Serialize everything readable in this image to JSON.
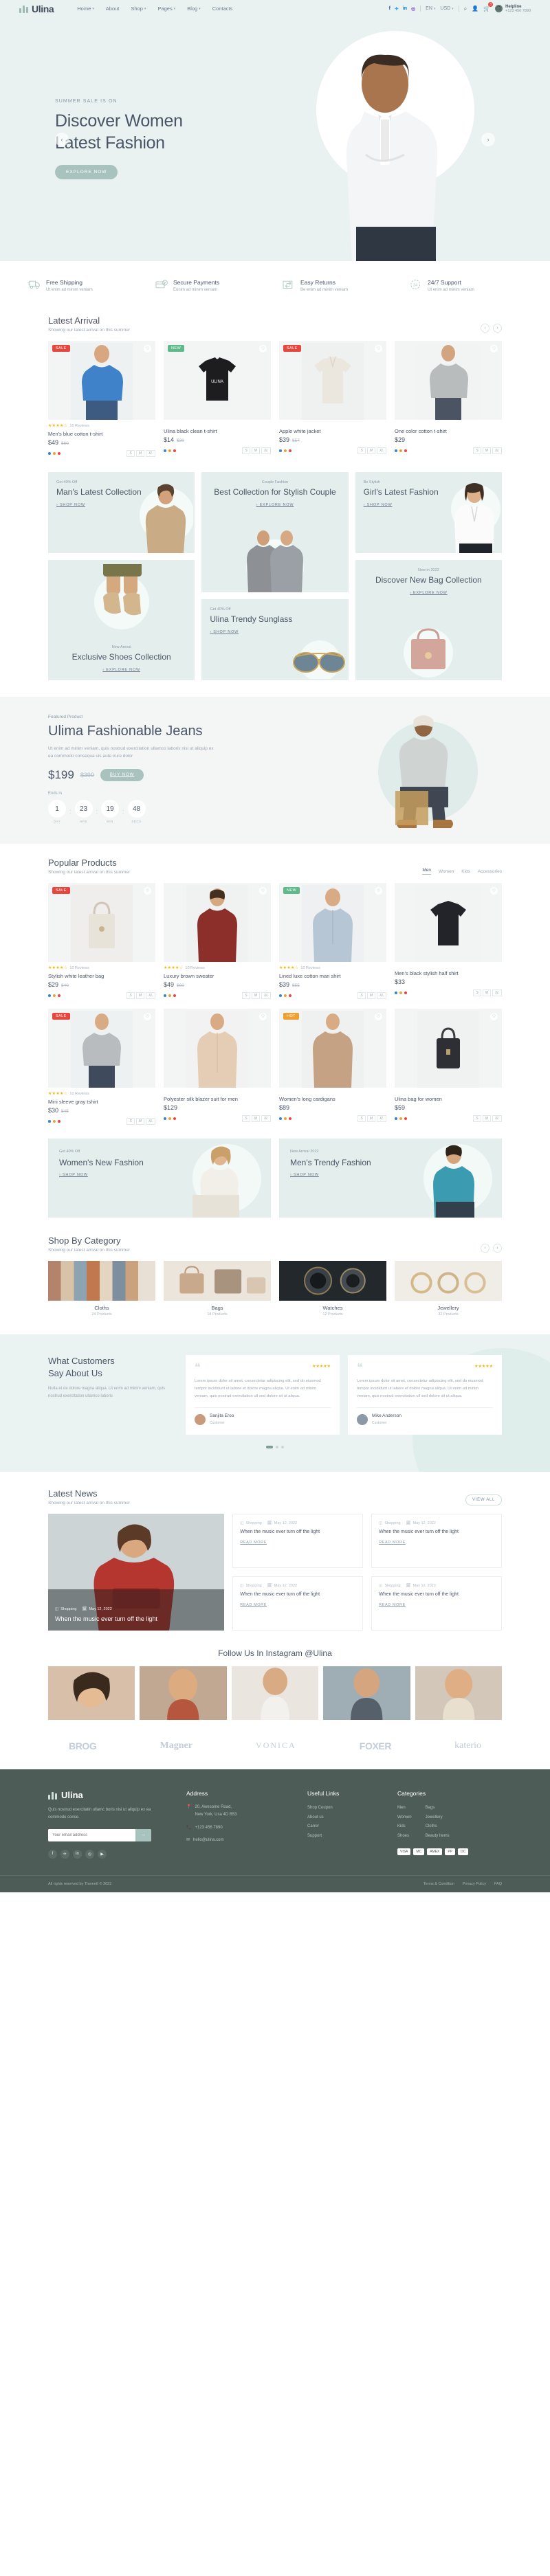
{
  "header": {
    "brand": "Ulina",
    "nav": [
      {
        "label": "Home",
        "caret": true
      },
      {
        "label": "About",
        "caret": false
      },
      {
        "label": "Shop",
        "caret": true
      },
      {
        "label": "Pages",
        "caret": true
      },
      {
        "label": "Blog",
        "caret": true
      },
      {
        "label": "Contacts",
        "caret": false
      }
    ],
    "socials": [
      "f",
      "t",
      "in",
      "ig"
    ],
    "language": "EN",
    "currency": "USD",
    "cart_count": "3",
    "helpline_label": "Helpline",
    "helpline_number": "+123 456 7890"
  },
  "hero": {
    "eyebrow": "SUMMER SALE IS ON",
    "title_line1": "Discover Women",
    "title_line2": "Latest Fashion",
    "cta": "EXPLORE NOW",
    "prev": "‹",
    "next": "›"
  },
  "features": [
    {
      "icon": "truck-icon",
      "title": "Free Shipping",
      "sub": "Ut enim ad minim veniam"
    },
    {
      "icon": "card-shield-icon",
      "title": "Secure Payments",
      "sub": "Eonim ad minim veniam"
    },
    {
      "icon": "return-box-icon",
      "title": "Easy Returns",
      "sub": "Be enim ad minim veniam"
    },
    {
      "icon": "clock-24-icon",
      "title": "24/7 Support",
      "sub": "Ut enim ad minim veniam"
    }
  ],
  "latest_arrival": {
    "title": "Latest Arrival",
    "subtitle": "Showing our latest arrival on this summer",
    "products": [
      {
        "tag": "SALE",
        "tag_type": "sale",
        "name": "Men's blue cotton t-shirt",
        "price": "$49",
        "old": "$60",
        "stars": "★★★★☆",
        "reviews": "10 Reviews",
        "colors": [
          "#3b82c4",
          "#e8a33d",
          "#e8473f"
        ],
        "sizes": [
          "S",
          "M",
          "XL"
        ],
        "photo": "men-blue-tshirt"
      },
      {
        "tag": "NEW",
        "tag_type": "new",
        "name": "Ulina black clean t-shirt",
        "price": "$14",
        "old": "$30",
        "stars": "",
        "reviews": "",
        "colors": [
          "#3b82c4",
          "#e8a33d",
          "#e8473f"
        ],
        "sizes": [
          "S",
          "M",
          "XL"
        ],
        "photo": "black-tshirt"
      },
      {
        "tag": "SALE",
        "tag_type": "sale",
        "name": "Apple white jacket",
        "price": "$39",
        "old": "$57",
        "stars": "",
        "reviews": "",
        "colors": [
          "#3b82c4",
          "#e8a33d",
          "#e8473f"
        ],
        "sizes": [
          "S",
          "M",
          "XL"
        ],
        "photo": "white-jacket"
      },
      {
        "tag": "",
        "tag_type": "",
        "name": "One color cotton t-shirt",
        "price": "$29",
        "old": "",
        "stars": "",
        "reviews": "",
        "colors": [
          "#3b82c4",
          "#e8a33d",
          "#e8473f"
        ],
        "sizes": [
          "S",
          "M",
          "XL"
        ],
        "photo": "grey-sweater"
      }
    ]
  },
  "collections": [
    {
      "eyebrow": "Get 40% Off",
      "title": "Man's Latest Collection",
      "link": "SHOP NOW",
      "name": "mans-latest-collection"
    },
    {
      "eyebrow": "Couple Fashion",
      "title": "Best Collection for Stylish Couple",
      "link": "EXPLORE NOW",
      "name": "couple-collection"
    },
    {
      "eyebrow": "Be Stylish",
      "title": "Girl's Latest Fashion",
      "link": "SHOP NOW",
      "name": "girls-latest-fashion"
    },
    {
      "eyebrow": "New Arrival",
      "title": "Exclusive Shoes Collection",
      "link": "EXPLORE NOW",
      "name": "exclusive-shoes"
    },
    {
      "eyebrow": "Get 40% Off",
      "title": "Ulina Trendy Sunglass",
      "link": "SHOP NOW",
      "name": "trendy-sunglass"
    },
    {
      "eyebrow": "New in 2022",
      "title": "Discover New Bag Collection",
      "link": "EXPLORE NOW",
      "name": "new-bag-collection"
    }
  ],
  "deal": {
    "eyebrow": "Featured Product",
    "title": "Ulima Fashionable Jeans",
    "desc": "Ut enim ad minim veniam, quis nostrud exercitation ullamco laboris nisi ut aliquip ex ea commodo consequa uis aute irure dolor",
    "price": "$199",
    "old_price": "$399",
    "cta": "BUY NOW",
    "ends_label": "Ends in",
    "timer": [
      {
        "value": "1",
        "label": "DAY"
      },
      {
        "value": "23",
        "label": "HRS"
      },
      {
        "value": "19",
        "label": "MIN"
      },
      {
        "value": "48",
        "label": "SECS"
      }
    ]
  },
  "popular": {
    "title": "Popular Products",
    "subtitle": "Showing our latest arrival on this summer",
    "filters": [
      "Men",
      "Women",
      "Kids",
      "Accessories"
    ],
    "active_filter": "Men",
    "products": [
      {
        "tag": "SALE",
        "tag_type": "sale",
        "name": "Stylish white leather bag",
        "price": "$29",
        "old": "$40",
        "stars": "★★★★☆",
        "reviews": "10 Reviews",
        "colors": [
          "#3b82c4",
          "#e8a33d",
          "#e8473f"
        ],
        "sizes": [
          "S",
          "M",
          "XL"
        ],
        "photo": "white-leather-bag"
      },
      {
        "tag": "",
        "tag_type": "",
        "name": "Luxury brown sweater",
        "price": "$49",
        "old": "$60",
        "stars": "★★★★☆",
        "reviews": "10 Reviews",
        "colors": [
          "#3b82c4",
          "#e8a33d",
          "#e8473f"
        ],
        "sizes": [
          "S",
          "M",
          "XL"
        ],
        "photo": "brown-sweater"
      },
      {
        "tag": "NEW",
        "tag_type": "new",
        "name": "Lined luxe cotton man shirt",
        "price": "$39",
        "old": "$55",
        "stars": "★★★★☆",
        "reviews": "10 Reviews",
        "colors": [
          "#3b82c4",
          "#e8a33d",
          "#e8473f"
        ],
        "sizes": [
          "S",
          "M",
          "XL"
        ],
        "photo": "cotton-man-shirt"
      },
      {
        "tag": "",
        "tag_type": "",
        "name": "Men's black stylish half shirt",
        "price": "$33",
        "old": "",
        "stars": "",
        "reviews": "",
        "colors": [
          "#3b82c4",
          "#e8a33d",
          "#e8473f"
        ],
        "sizes": [
          "S",
          "M",
          "XL"
        ],
        "photo": "black-half-shirt"
      },
      {
        "tag": "SALE",
        "tag_type": "sale",
        "name": "Mini sleeve gray tshirt",
        "price": "$30",
        "old": "$45",
        "stars": "★★★★☆",
        "reviews": "10 Reviews",
        "colors": [
          "#3b82c4",
          "#e8a33d",
          "#e8473f"
        ],
        "sizes": [
          "S",
          "M",
          "XL"
        ],
        "photo": "gray-tshirt"
      },
      {
        "tag": "",
        "tag_type": "",
        "name": "Polyester silk blazer suit for men",
        "price": "$129",
        "old": "",
        "stars": "",
        "reviews": "",
        "colors": [
          "#3b82c4",
          "#e8a33d",
          "#e8473f"
        ],
        "sizes": [
          "S",
          "M",
          "XL"
        ],
        "photo": "blazer-suit"
      },
      {
        "tag": "HOT",
        "tag_type": "hot",
        "name": "Women's long cardigans",
        "price": "$89",
        "old": "",
        "stars": "",
        "reviews": "",
        "colors": [
          "#3b82c4",
          "#e8a33d",
          "#e8473f"
        ],
        "sizes": [
          "S",
          "M",
          "XL"
        ],
        "photo": "long-cardigan"
      },
      {
        "tag": "",
        "tag_type": "",
        "name": "Ulina bag for women",
        "price": "$59",
        "old": "",
        "stars": "",
        "reviews": "",
        "colors": [
          "#3b82c4",
          "#e8a33d",
          "#e8473f"
        ],
        "sizes": [
          "S",
          "M",
          "XL"
        ],
        "photo": "women-bag"
      }
    ]
  },
  "two_banners": [
    {
      "eyebrow": "Get 40% Off",
      "title": "Women's New Fashion",
      "link": "SHOP NOW",
      "name": "womens-new-fashion"
    },
    {
      "eyebrow": "New Arrival 2022",
      "title": "Men's Trendy Fashion",
      "link": "SHOP NOW",
      "name": "mens-trendy-fashion"
    }
  ],
  "category": {
    "title": "Shop By Category",
    "subtitle": "Showing our latest arrival on this summer",
    "items": [
      {
        "name": "Cloths",
        "count": "24 Products",
        "photo": "cloths-rack"
      },
      {
        "name": "Bags",
        "count": "18 Products",
        "photo": "bags-shelf"
      },
      {
        "name": "Watches",
        "count": "12 Products",
        "photo": "watches"
      },
      {
        "name": "Jewellery",
        "count": "32 Products",
        "photo": "jewellery"
      }
    ]
  },
  "testimonials": {
    "title_line1": "What Customers",
    "title_line2": "Say About Us",
    "desc": "Nulla et de dolore magna aliqua. Ut enim ad minim veniam, quis nostrud exercitation ullamco laboris",
    "cards": [
      {
        "stars": "★★★★★",
        "text": "Lorem ipsum dolor sit amet, consectetur adipiscing elit, sed do eiusmod tempor incididunt ut labore et dolore magna aliqua. Ut enim ad minim veniam, quis nostrud exercitation ull sed dolore sit ut aliqua.",
        "name": "Sanjita Eroo",
        "role": "Customer"
      },
      {
        "stars": "★★★★★",
        "text": "Lorem ipsum dolor sit amet, consectetur adipiscing elit, sed do eiusmod tempor incididunt ut labore et dolore magna aliqua. Ut enim ad minim veniam, quis nostrud exercitation ull sed dolore sit ut aliqua.",
        "name": "Mike Anderson",
        "role": "Customer"
      }
    ]
  },
  "news": {
    "title": "Latest News",
    "subtitle": "Showing our latest arrival on this summer",
    "view_all": "VIEW ALL",
    "featured": {
      "author_label": "Shopping",
      "date": "May 12, 2022",
      "headline": "When the music ever turn off the light"
    },
    "items": [
      {
        "author_label": "Shopping",
        "date": "May 12, 2022",
        "headline": "When the music ever turn off the light",
        "read_more": "READ MORE"
      },
      {
        "author_label": "Shopping",
        "date": "May 12, 2022",
        "headline": "When the music ever turn off the light",
        "read_more": "READ MORE"
      },
      {
        "author_label": "Shopping",
        "date": "May 12, 2022",
        "headline": "When the music ever turn off the light",
        "read_more": "READ MORE"
      },
      {
        "author_label": "Shopping",
        "date": "May 12, 2022",
        "headline": "When the music ever turn off the light",
        "read_more": "READ MORE"
      }
    ]
  },
  "instagram": {
    "title": "Follow Us In Instagram @Ulina",
    "cells": [
      "insta-1",
      "insta-2",
      "insta-3",
      "insta-4",
      "insta-5"
    ]
  },
  "brands": [
    "BROG",
    "Magner",
    "VONICA",
    "FOXER",
    "katerio"
  ],
  "footer": {
    "brand": "Ulina",
    "desc": "Quis nostrud exercitatin ullamc boris nisi ut aliquip ex ea commodo conse.",
    "newsletter_placeholder": "Your email address",
    "newsletter_btn": "→",
    "socials": [
      "f",
      "t",
      "in",
      "ig",
      "yt"
    ],
    "address": {
      "heading": "Address",
      "street": "20, Awesome Road,",
      "city": "New York, Usa 4D B53",
      "phone": "+123 456 7890",
      "email": "hello@ulina.com"
    },
    "useful_links": {
      "heading": "Useful Links",
      "items": [
        "Shop Coupon",
        "About us",
        "Carrer",
        "Support"
      ]
    },
    "categories": {
      "heading": "Categories",
      "col1": [
        "Men",
        "Women",
        "Kids",
        "Shoes"
      ],
      "col2": [
        "Bags",
        "Jewellery",
        "Cloths",
        "Beauty Items"
      ]
    },
    "payments": [
      "VISA",
      "MC",
      "AMEX",
      "PP",
      "DC"
    ],
    "copyright": "All rights reserved by Themetf © 2022",
    "bottom_links": [
      "Terms & Condition",
      "Privacy Policy",
      "FAQ"
    ]
  }
}
